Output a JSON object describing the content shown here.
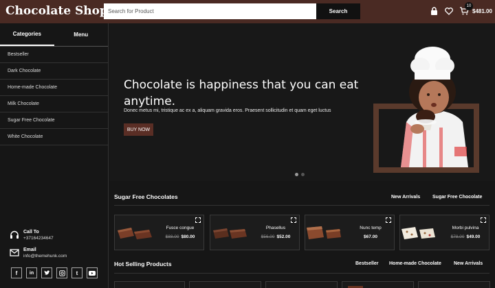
{
  "header": {
    "logo": "Chocolate Shop",
    "search_placeholder": "Search for Product",
    "search_button": "Search",
    "cart_count": "10",
    "cart_total": "$481.00"
  },
  "sidebar": {
    "tabs": [
      "Categories",
      "Menu"
    ],
    "categories": [
      "Bestseller",
      "Dark Chocolate",
      "Home-made Chocolate",
      "Milk Chocolate",
      "Sugar Free Chocolate",
      "White Chocolate"
    ],
    "call": {
      "title": "Call To",
      "value": "+37164234647"
    },
    "email": {
      "title": "Email",
      "value": "info@themehunk.com"
    },
    "social_icons": [
      "f",
      "in",
      "tw",
      "ig",
      "t",
      "yt"
    ]
  },
  "hero": {
    "title": "Chocolate is happiness that you can eat anytime.",
    "subtitle": "Donec metus mi, tristique ac ex a, aliquam gravida eros. Praesent sollicitudin et quam eget luctus",
    "button": "BUY NOW",
    "slides": 2,
    "active_slide": 1
  },
  "sugar_free": {
    "title": "Sugar Free Chocolates",
    "tabs": [
      "New Arrivals",
      "Sugar Free Chocolate"
    ],
    "products": [
      {
        "name": "Fusce congue",
        "old_price": "$88.00",
        "price": "$80.00"
      },
      {
        "name": "Phasellus",
        "old_price": "$56.00",
        "price": "$52.00"
      },
      {
        "name": "Nunc temp",
        "old_price": "",
        "price": "$67.00"
      },
      {
        "name": "Morbi pulvina",
        "old_price": "$78.00",
        "price": "$49.00"
      }
    ]
  },
  "hot_selling": {
    "title": "Hot Selling Products",
    "tabs": [
      "Bestseller",
      "Home-made Chocolate",
      "New Arrivals"
    ]
  },
  "colors": {
    "header_bg": "#4a2a23",
    "accent": "#5a2e25",
    "page_bg": "#161616"
  }
}
